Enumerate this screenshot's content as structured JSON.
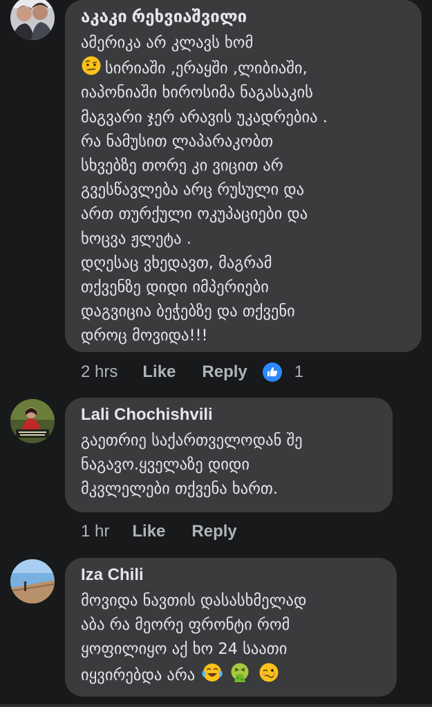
{
  "comments": [
    {
      "author": "აკაკი რეხვიაშვილი",
      "lines": [
        "ამერიკა არ კლავს ხომ",
        "სირიაში ,ერაყში ,ლიბიაში,",
        "იაპონიაში ხიროსიმა ნაგასაკის",
        "მაგვარი ჯერ არავის უკადრებია .",
        "რა ნამუსით ლაპარაკობთ",
        "სხვებზე თორე კი ვიცით არ",
        "გვესწავლება არც რუსული და",
        "ართ თურქული ოკუპაციები და",
        "ხოცვა ჟლეტა .",
        "დღესაც ვხედავთ, მაგრამ",
        "თქვენზე დიდი იმპერიები",
        "დაგვიცია ბეჭებზე და თქვენი",
        "დროც მოვიდა!!!"
      ],
      "time": "2 hrs",
      "like_label": "Like",
      "reply_label": "Reply",
      "reaction_icon": "like-thumb-icon",
      "reaction_count": "1"
    },
    {
      "author": "Lali Chochishvili",
      "lines": [
        "გაეთრიე საქართველოდან შე",
        "ნაგავო.ყველაზე დიდი",
        "მკვლელები თქვენა ხართ."
      ],
      "time": "1 hr",
      "like_label": "Like",
      "reply_label": "Reply"
    },
    {
      "author": "Iza Chili",
      "lines": [
        "მოვიდა ნავთის დასასხმელად",
        "აბა რა მეორე ფრონტი რომ",
        "ყოფილიყო აქ ხო 24 საათი",
        "იყვირებდა არა"
      ]
    }
  ],
  "emojis": {
    "c1_line2": "raised-eyebrow-emoji",
    "c3_line4": [
      "tears-of-joy-emoji",
      "vomiting-face-emoji",
      "woozy-face-emoji"
    ]
  },
  "colors": {
    "background": "#18191a",
    "bubble": "#3a3b3c",
    "text": "#e4e6eb",
    "secondary_text": "#b0b3b8",
    "like_badge": "#2d88ff"
  }
}
